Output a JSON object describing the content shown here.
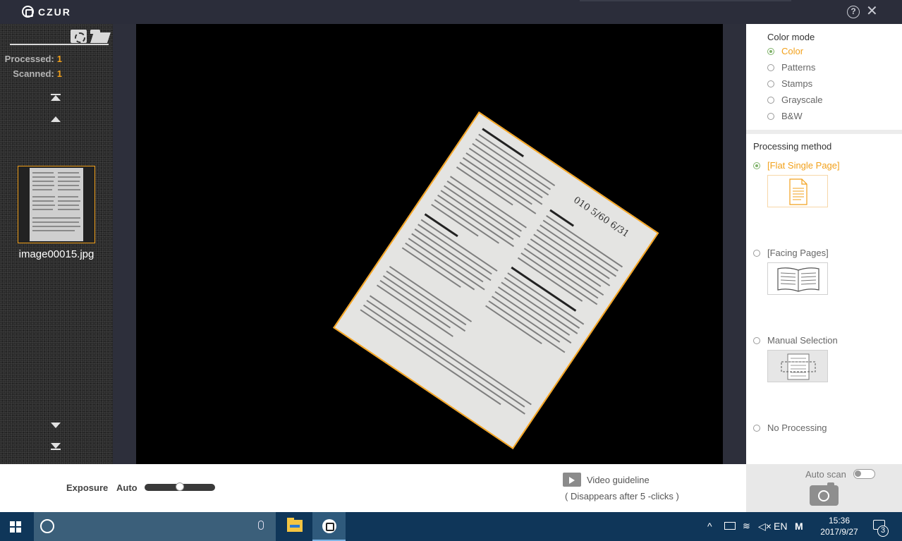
{
  "app": {
    "logo_text": "CZUR"
  },
  "titlebar": {
    "help_label": "?",
    "close_label": "✕"
  },
  "sidebar": {
    "processed_label": "Processed:",
    "processed_count": "1",
    "scanned_label": "Scanned:",
    "scanned_count": "1",
    "thumbnails": [
      {
        "filename": "image00015.jpg"
      }
    ]
  },
  "preview": {
    "handwritten_note": "010 5/60 6/31"
  },
  "right_panel": {
    "color_mode_title": "Color mode",
    "color_modes": [
      {
        "label": "Color",
        "selected": true
      },
      {
        "label": "Patterns",
        "selected": false
      },
      {
        "label": "Stamps",
        "selected": false
      },
      {
        "label": "Grayscale",
        "selected": false
      },
      {
        "label": "B&W",
        "selected": false
      }
    ],
    "processing_title": "Processing method",
    "processing_methods": [
      {
        "label": "[Flat Single Page]",
        "selected": true,
        "icon": "flat-page-icon"
      },
      {
        "label": "[Facing Pages]",
        "selected": false,
        "icon": "facing-pages-icon"
      },
      {
        "label": "Manual Selection",
        "selected": false,
        "icon": "manual-selection-icon"
      },
      {
        "label": "No Processing",
        "selected": false
      }
    ]
  },
  "bottom": {
    "exposure_label": "Exposure",
    "auto_label": "Auto",
    "exposure_level": 0.5,
    "video_guideline_label": "Video guideline",
    "video_guideline_note": "( Disappears after 5 -clicks )",
    "auto_scan_label": "Auto scan",
    "auto_scan_on": false
  },
  "taskbar": {
    "tray_lang": "EN",
    "tray_ime": "M",
    "time": "15:36",
    "date": "2017/9/27",
    "notification_count": "3"
  },
  "colors": {
    "accent": "#f2a11b",
    "radio_on": "#7fb26a",
    "taskbar": "#0f3659",
    "titlebar": "#2b2d3a"
  }
}
